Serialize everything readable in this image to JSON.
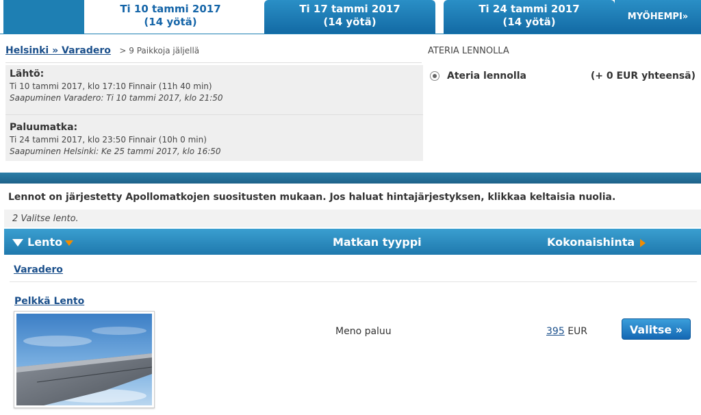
{
  "tabs": [
    {
      "date": "Ti 10 tammi 2017",
      "nights": "(14 yötä)"
    },
    {
      "date": "Ti 17 tammi 2017",
      "nights": "(14 yötä)"
    },
    {
      "date": "Ti 24 tammi 2017",
      "nights": "(14 yötä)"
    }
  ],
  "later_label": "MYÖHEMPI»",
  "route": {
    "link": "Helsinki » Varadero",
    "seats": "> 9 Paikkoja jäljellä"
  },
  "outbound": {
    "heading": "Lähtö:",
    "details": "Ti 10 tammi 2017, klo 17:10 Finnair (11h 40 min)",
    "arrival": "Saapuminen Varadero: Ti 10 tammi 2017, klo 21:50"
  },
  "return": {
    "heading": "Paluumatka:",
    "details": "Ti 24 tammi 2017, klo 23:50 Finnair (10h 0 min)",
    "arrival": "Saapuminen Helsinki: Ke 25 tammi 2017, klo 16:50"
  },
  "meal": {
    "title": "ATERIA LENNOLLA",
    "option": "Ateria lennolla",
    "price": "(+ 0 EUR yhteensä)"
  },
  "note": "Lennot on järjestetty Apollomatkojen suositusten mukaan. Jos haluat hintajärjestyksen, klikkaa keltaisia nuolia.",
  "step": "2 Valitse lento.",
  "table": {
    "col_flight": "Lento",
    "col_type": "Matkan tyyppi",
    "col_price": "Kokonaishinta"
  },
  "destination": "Varadero",
  "result": {
    "product": "Pelkkä Lento",
    "trip_type": "Meno paluu",
    "price": "395",
    "currency": "EUR",
    "select_label": "Valitse »"
  },
  "colors": {
    "tab_blue": "#1e7fb3",
    "link": "#1a4f8b",
    "sort_arrow": "#f28c00"
  }
}
